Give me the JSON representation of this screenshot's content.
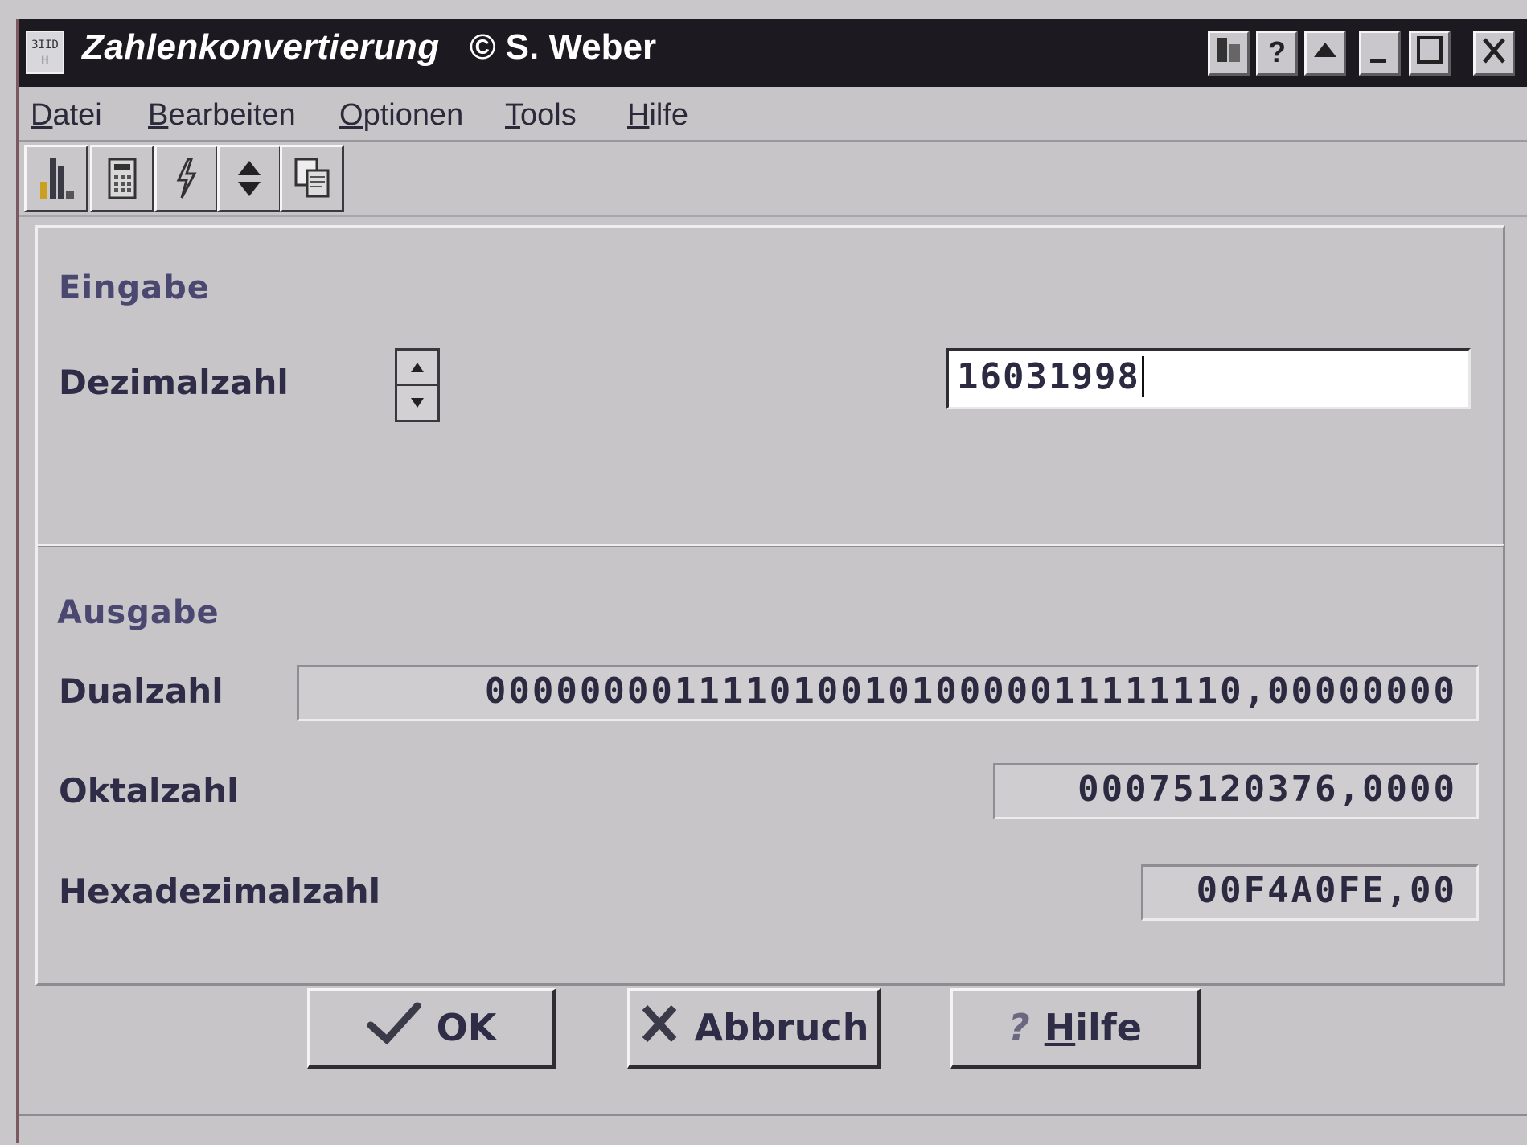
{
  "window": {
    "title": "Zahlenkonvertierung",
    "subtitle": "© S. Weber",
    "app_icon_text": "ЗIID\nH"
  },
  "titlebar_buttons": [
    "⌘",
    "?",
    "^",
    "_",
    "□",
    "X"
  ],
  "menu": [
    {
      "label": "Datei",
      "accel": "D"
    },
    {
      "label": "Bearbeiten",
      "accel": "B"
    },
    {
      "label": "Optionen",
      "accel": "O"
    },
    {
      "label": "Tools",
      "accel": "T"
    },
    {
      "label": "Hilfe",
      "accel": "H"
    }
  ],
  "toolbar": [
    "bar-chart-icon",
    "calculator-icon",
    "lightning-icon",
    "up-down-icon",
    "copy-icon"
  ],
  "input_group": {
    "title": "Eingabe",
    "decimal_label": "Dezimalzahl",
    "decimal_value": "16031998"
  },
  "output_group": {
    "title": "Ausgabe",
    "binary_label": "Dualzahl",
    "binary_value": "00000000111101001010000011111110,00000000",
    "octal_label": "Oktalzahl",
    "octal_value": "00075120376,0000",
    "hex_label": "Hexadezimalzahl",
    "hex_value": "00F4A0FE,00"
  },
  "buttons": {
    "ok": "OK",
    "cancel": "Abbruch",
    "help": "Hilfe"
  },
  "colors": {
    "titlebar": "#1c1a20",
    "window_bg": "#c7c5c7",
    "label_text": "#2e2c46",
    "group_title": "#4a4870"
  }
}
